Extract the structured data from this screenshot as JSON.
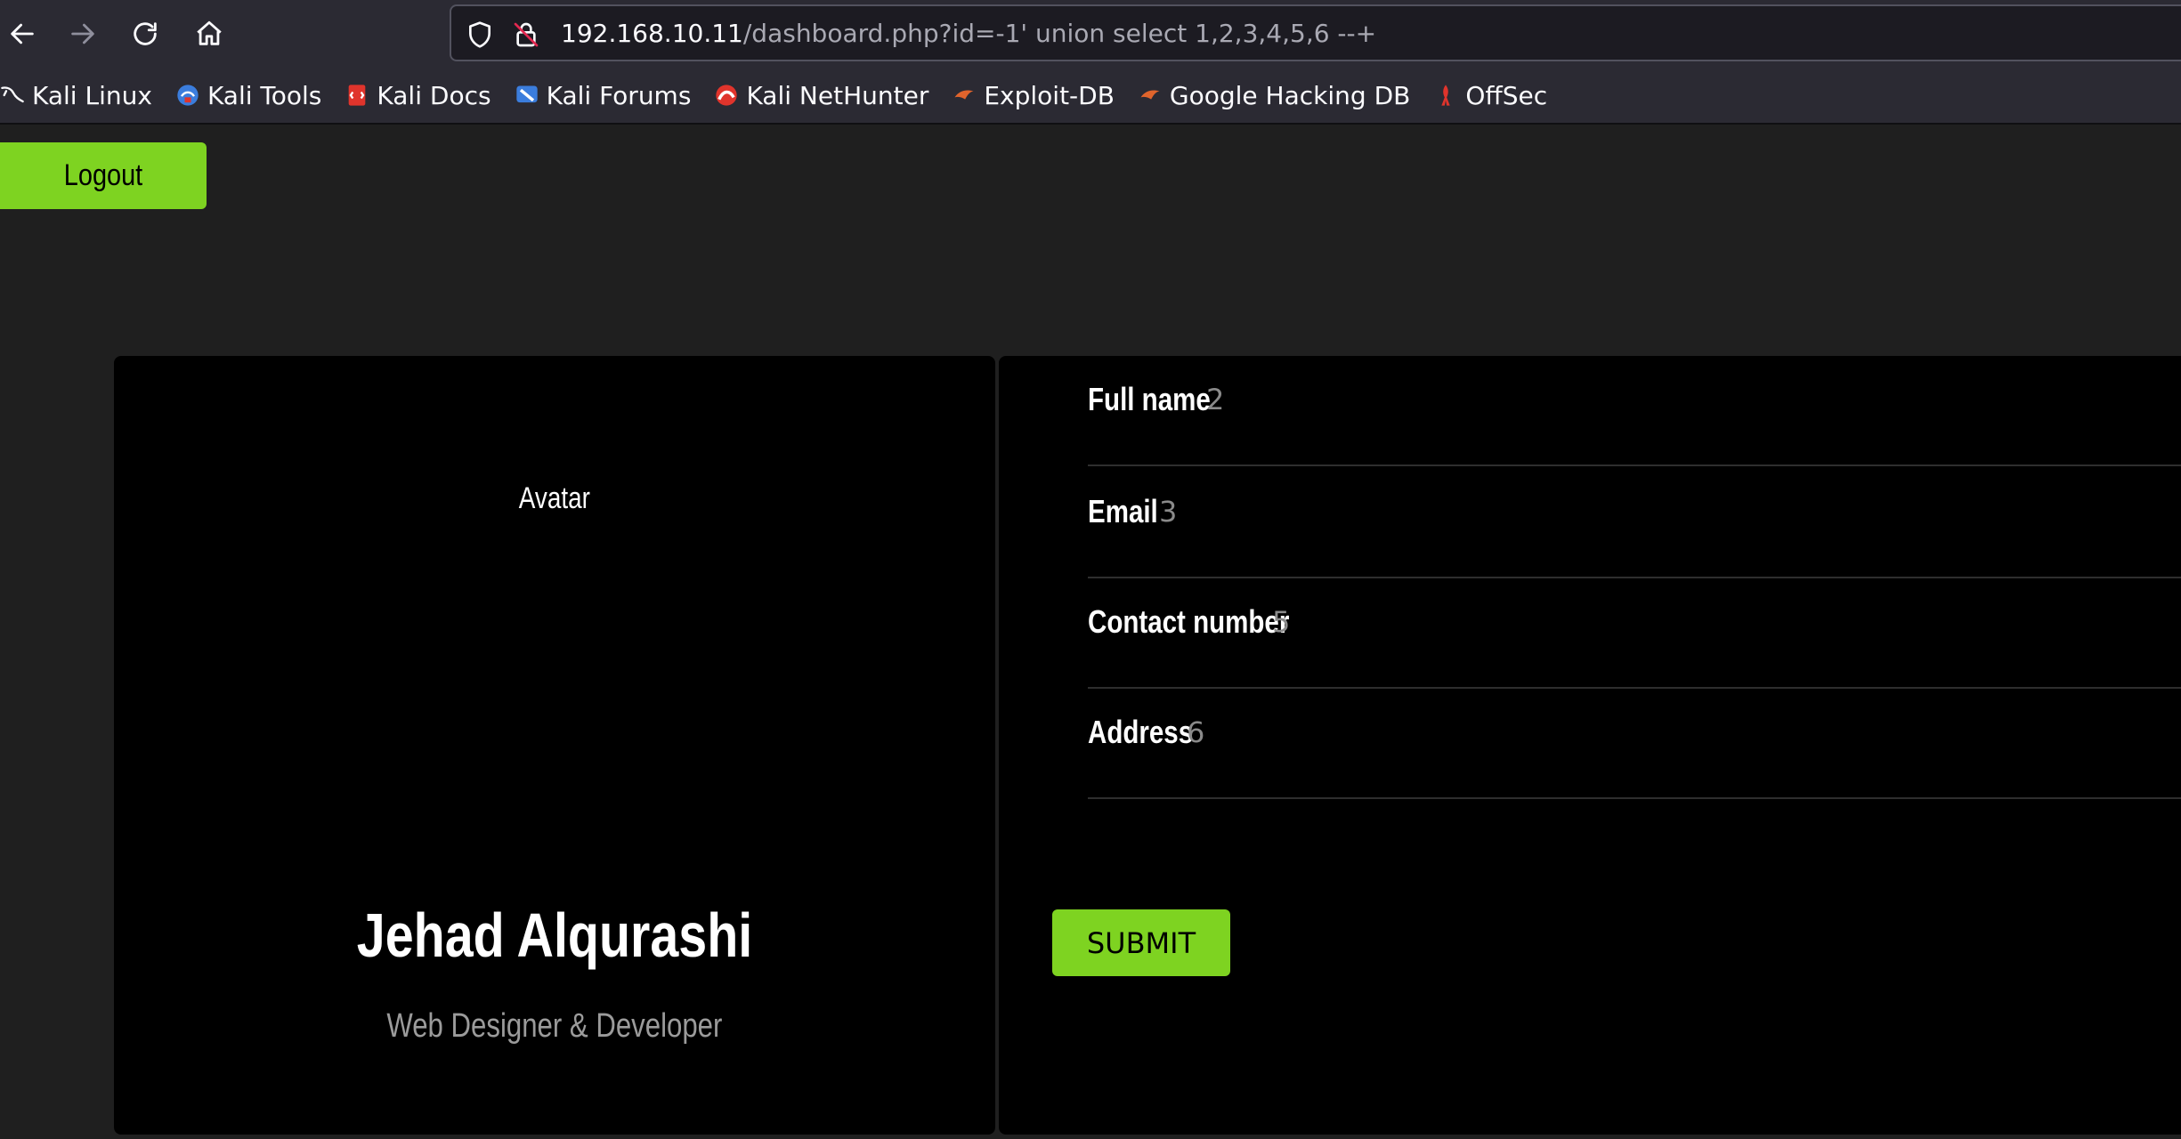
{
  "browser": {
    "url_host": "192.168.10.11",
    "url_path": "/dashboard.php?id=-1' union select 1,2,3,4,5,6 --+",
    "bookmarks": [
      {
        "label": "Kali Linux",
        "icon": "kali-dragon-icon",
        "color": "#ffffff"
      },
      {
        "label": "Kali Tools",
        "icon": "kali-tools-icon",
        "color": "#3b7ddd"
      },
      {
        "label": "Kali Docs",
        "icon": "kali-docs-icon",
        "color": "#e0342c"
      },
      {
        "label": "Kali Forums",
        "icon": "kali-forums-icon",
        "color": "#3b7ddd"
      },
      {
        "label": "Kali NetHunter",
        "icon": "kali-nethunter-icon",
        "color": "#e0342c"
      },
      {
        "label": "Exploit-DB",
        "icon": "exploit-db-icon",
        "color": "#e0642c"
      },
      {
        "label": "Google Hacking DB",
        "icon": "ghdb-icon",
        "color": "#e0642c"
      },
      {
        "label": "OffSec",
        "icon": "offsec-icon",
        "color": "#e0342c"
      }
    ]
  },
  "page": {
    "logout_label": "Logout",
    "avatar_label": "Avatar",
    "profile_name": "Jehad Alqurashi",
    "profile_role": "Web Designer & Developer",
    "fields": [
      {
        "label": "Full name",
        "value": "2"
      },
      {
        "label": "Email",
        "value": "3"
      },
      {
        "label": "Contact number",
        "value": "5"
      },
      {
        "label": "Address",
        "value": "6"
      }
    ],
    "submit_label": "SUBMIT",
    "accent_color": "#7ed321"
  }
}
